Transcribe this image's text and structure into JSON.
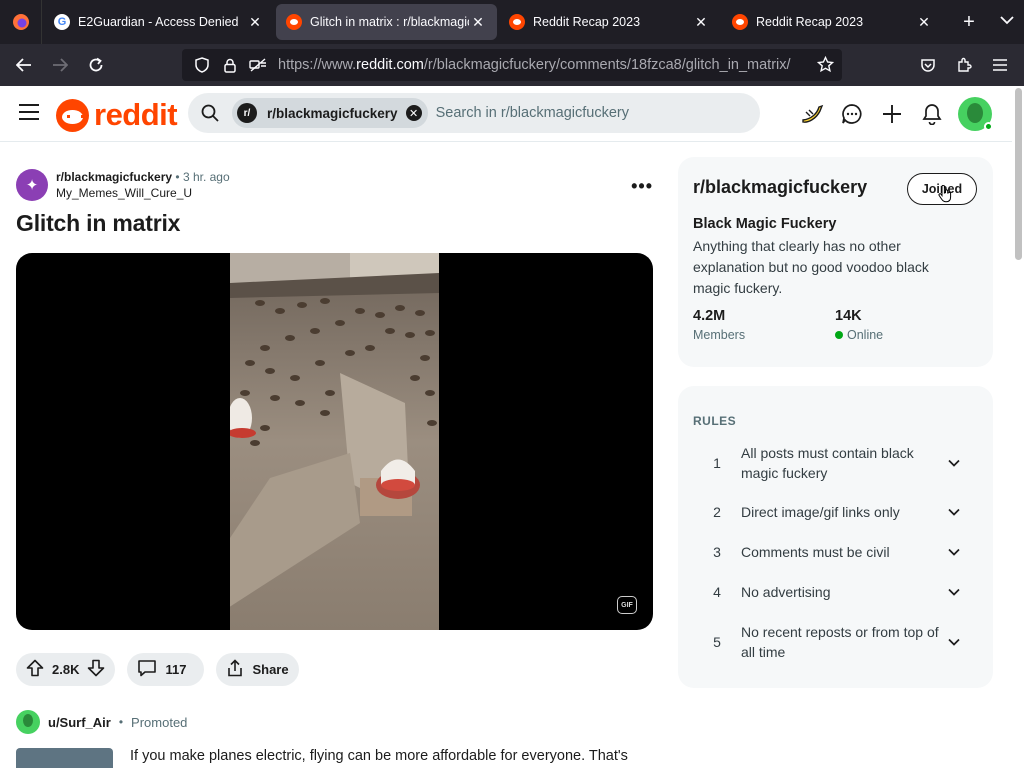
{
  "browser": {
    "tabs": [
      {
        "title": "E2Guardian - Access Denied",
        "favicon": "google-icon",
        "active": false
      },
      {
        "title": "Glitch in matrix : r/blackmagicfuckery",
        "favicon": "reddit-icon",
        "active": true
      },
      {
        "title": "Reddit Recap 2023",
        "favicon": "reddit-icon",
        "active": false
      },
      {
        "title": "Reddit Recap 2023",
        "favicon": "reddit-icon",
        "active": false
      }
    ],
    "url_prefix": "https://www.",
    "url_domain": "reddit.com",
    "url_path": "/r/blackmagicfuckery/comments/18fzca8/glitch_in_matrix/"
  },
  "header": {
    "logo_text": "reddit",
    "search_chip_icon": "r/",
    "search_chip": "r/blackmagicfuckery",
    "search_placeholder": "Search in r/blackmagicfuckery"
  },
  "post": {
    "subreddit": "r/blackmagicfuckery",
    "separator": "•",
    "time": "3 hr. ago",
    "author": "My_Memes_Will_Cure_U",
    "title": "Glitch in matrix",
    "media_badge": "GIF",
    "votes": "2.8K",
    "comments": "117",
    "share_label": "Share"
  },
  "promo": {
    "user": "u/Surf_Air",
    "separator": "•",
    "tag": "Promoted",
    "text": "If you make planes electric, flying can be more affordable for everyone. That's"
  },
  "sidebar": {
    "name": "r/blackmagicfuckery",
    "join_label": "Joined",
    "title": "Black Magic Fuckery",
    "description": "Anything that clearly has no other explanation but no good voodoo black magic fuckery.",
    "members_value": "4.2M",
    "members_label": "Members",
    "online_value": "14K",
    "online_label": "Online"
  },
  "rules": {
    "heading": "RULES",
    "items": [
      {
        "num": "1",
        "text": "All posts must contain black magic fuckery"
      },
      {
        "num": "2",
        "text": "Direct image/gif links only"
      },
      {
        "num": "3",
        "text": "Comments must be civil"
      },
      {
        "num": "4",
        "text": "No advertising"
      },
      {
        "num": "5",
        "text": "No recent reposts or from top of all time"
      }
    ]
  },
  "colors": {
    "brand": "#ff4500",
    "chrome_dark": "#1f1e25",
    "online_green": "#01a816"
  }
}
